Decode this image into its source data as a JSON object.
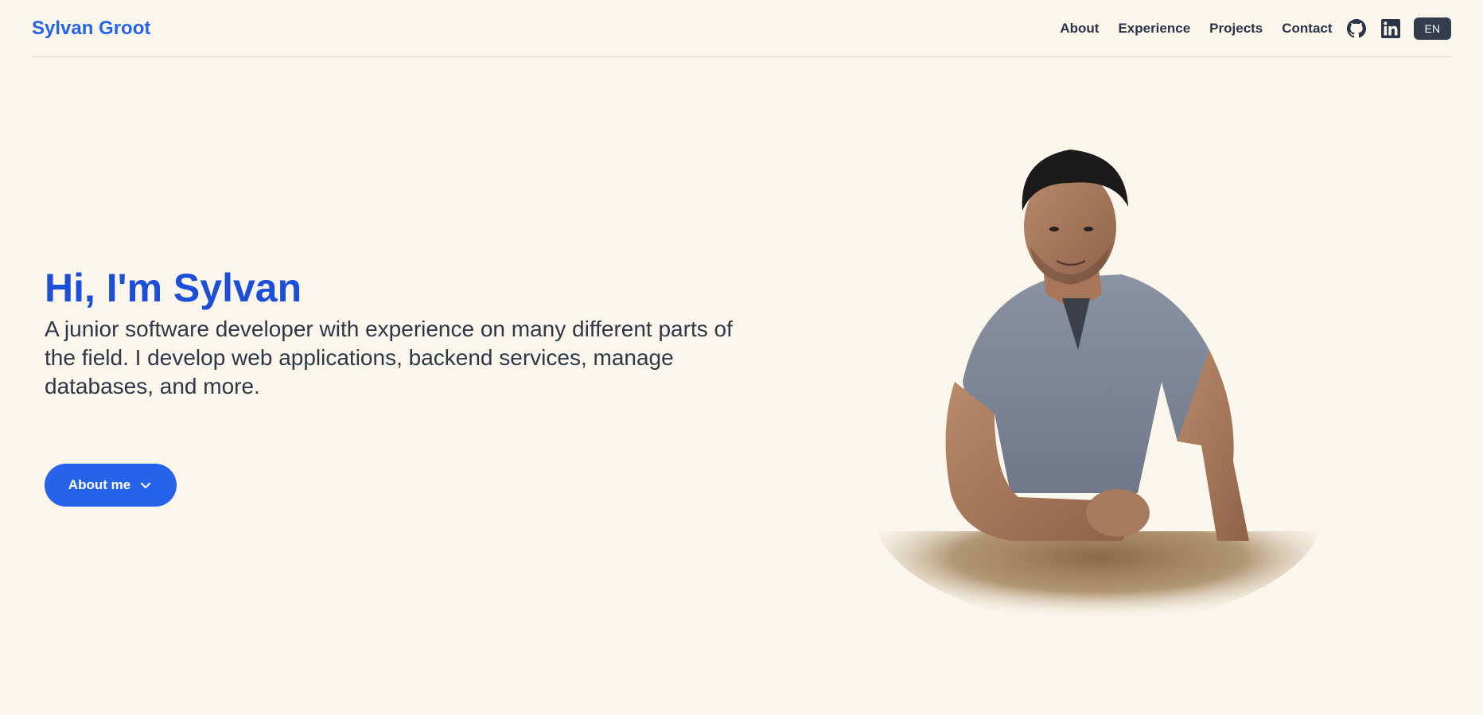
{
  "header": {
    "brand": "Sylvan Groot",
    "nav": [
      {
        "label": "About"
      },
      {
        "label": "Experience"
      },
      {
        "label": "Projects"
      },
      {
        "label": "Contact"
      }
    ],
    "icons": [
      "github-icon",
      "linkedin-icon"
    ],
    "language": "EN"
  },
  "hero": {
    "title": "Hi, I'm Sylvan",
    "subtitle": "A junior software developer with experience on many different parts of the field. I develop web applications, backend services, manage databases, and more.",
    "cta_label": "About me",
    "cta_icon": "chevron-down-icon"
  },
  "colors": {
    "background": "#faf6ec",
    "accent": "#2563eb",
    "title": "#1d4ed8",
    "text": "#2f3747",
    "button_dark": "#343c4e"
  }
}
